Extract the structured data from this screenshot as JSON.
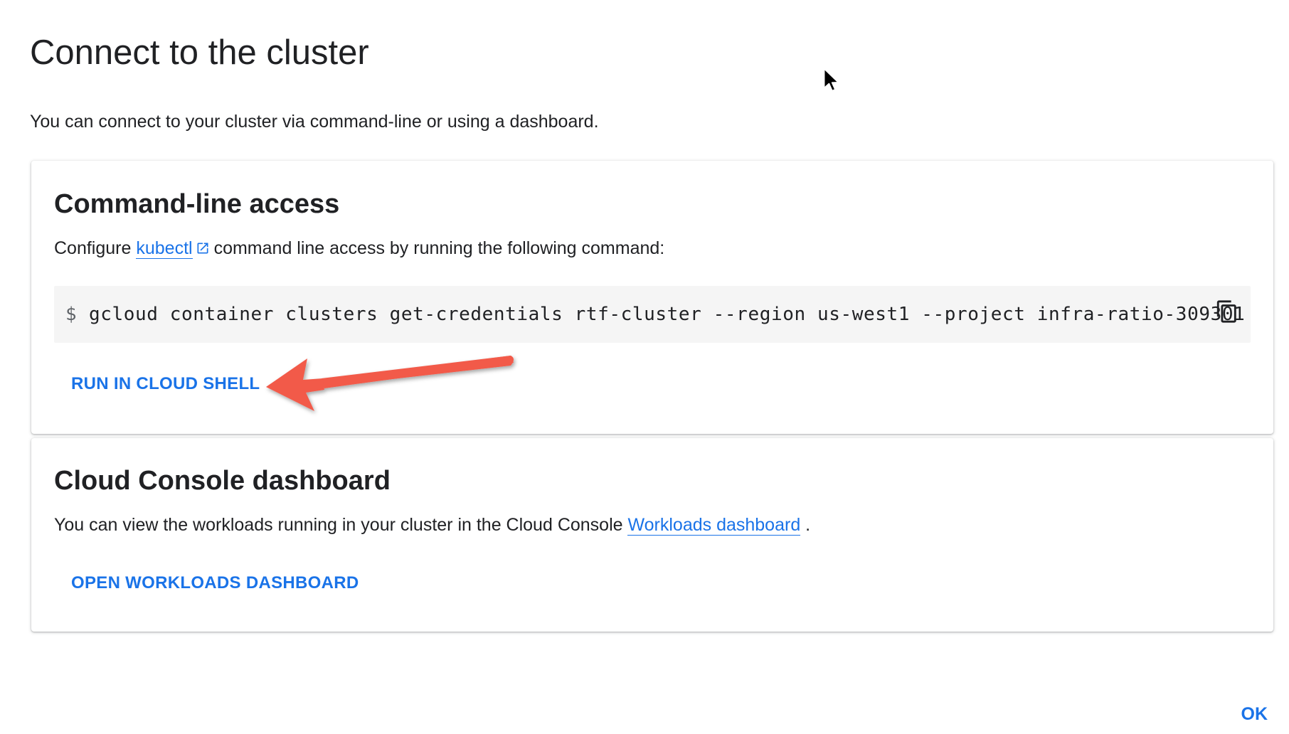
{
  "dialog": {
    "title": "Connect to the cluster",
    "subtitle": "You can connect to your cluster via command-line or using a dashboard.",
    "ok_label": "OK"
  },
  "cli_section": {
    "title": "Command-line access",
    "text_before_link": "Configure ",
    "link_label": "kubectl",
    "text_after_link": "command line access by running the following command:",
    "prompt": "$",
    "command": "gcloud container clusters get-credentials rtf-cluster --region us-west1 --project infra-ratio-309301",
    "run_button_label": "RUN IN CLOUD SHELL"
  },
  "dashboard_section": {
    "title": "Cloud Console dashboard",
    "text_before_link": "You can view the workloads running in your cluster in the Cloud Console ",
    "link_label": "Workloads dashboard",
    "text_after_link": " .",
    "open_button_label": "OPEN WORKLOADS DASHBOARD"
  },
  "colors": {
    "accent": "#1a73e8",
    "annotation_arrow": "#f25a4a",
    "code_background": "#f5f5f5"
  },
  "icons": {
    "external_link": "open-in-new-icon",
    "copy": "copy-icon",
    "cursor": "mouse-pointer-icon"
  }
}
